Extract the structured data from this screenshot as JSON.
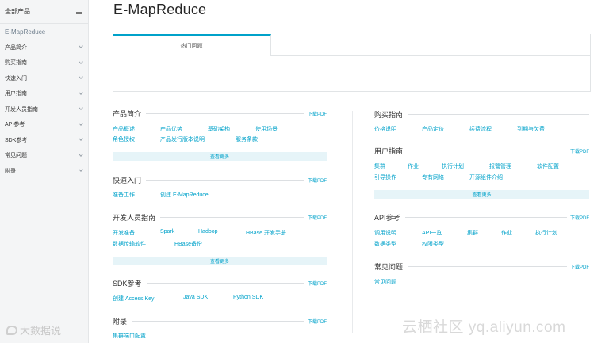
{
  "sidebar": {
    "header": "全部产品",
    "product": "E-MapReduce",
    "items": [
      {
        "label": "产品简介"
      },
      {
        "label": "购买指南"
      },
      {
        "label": "快速入门"
      },
      {
        "label": "用户指南"
      },
      {
        "label": "开发人员指南"
      },
      {
        "label": "API参考"
      },
      {
        "label": "SDK参考"
      },
      {
        "label": "常见问题"
      },
      {
        "label": "附录"
      }
    ]
  },
  "main": {
    "title": "E-MapReduce",
    "tabs": [
      {
        "label": "热门问题"
      }
    ]
  },
  "sections": {
    "intro": {
      "title": "产品简介",
      "pdf": "下载PDF",
      "links": [
        "产品概述",
        "产品优势",
        "基础架构",
        "使用场景",
        "角色授权",
        "产品发行版本说明",
        "服务条款"
      ],
      "more": "查看更多"
    },
    "quickstart": {
      "title": "快速入门",
      "pdf": "下载PDF",
      "links": [
        "准备工作",
        "创建 E-MapReduce"
      ]
    },
    "devguide": {
      "title": "开发人员指南",
      "pdf": "下载PDF",
      "links": [
        "开发准备",
        "Spark",
        "Hadoop",
        "HBase 开发手册",
        "数据传输软件",
        "HBase备份"
      ],
      "more": "查看更多"
    },
    "sdk": {
      "title": "SDK参考",
      "pdf": "下载PDF",
      "links": [
        "创建 Access Key",
        "Java SDK",
        "Python SDK"
      ]
    },
    "appendix": {
      "title": "附录",
      "pdf": "下载PDF",
      "links": [
        "集群端口配置"
      ]
    },
    "purchase": {
      "title": "购买指南",
      "links": [
        "价格说明",
        "产品定价",
        "续费流程",
        "到期与欠费"
      ]
    },
    "userguide": {
      "title": "用户指南",
      "pdf": "下载PDF",
      "links": [
        "集群",
        "作业",
        "执行计划",
        "报警管理",
        "软件配置",
        "引导操作",
        "专有网络",
        "开源组件介绍"
      ],
      "more": "查看更多"
    },
    "api": {
      "title": "API参考",
      "pdf": "下载PDF",
      "links": [
        "调用说明",
        "API一览",
        "集群",
        "作业",
        "执行计划",
        "数据类型",
        "权限类型"
      ]
    },
    "faq": {
      "title": "常见问题",
      "pdf": "下载PDF",
      "links": [
        "常见问题"
      ]
    }
  },
  "watermarks": {
    "left": "大数据说",
    "right": "云栖社区 yq.aliyun.com"
  },
  "colors": {
    "accent": "#00a2ca",
    "sidebar_bg": "#f4f5f6",
    "more_bg": "#e6f4f8"
  }
}
